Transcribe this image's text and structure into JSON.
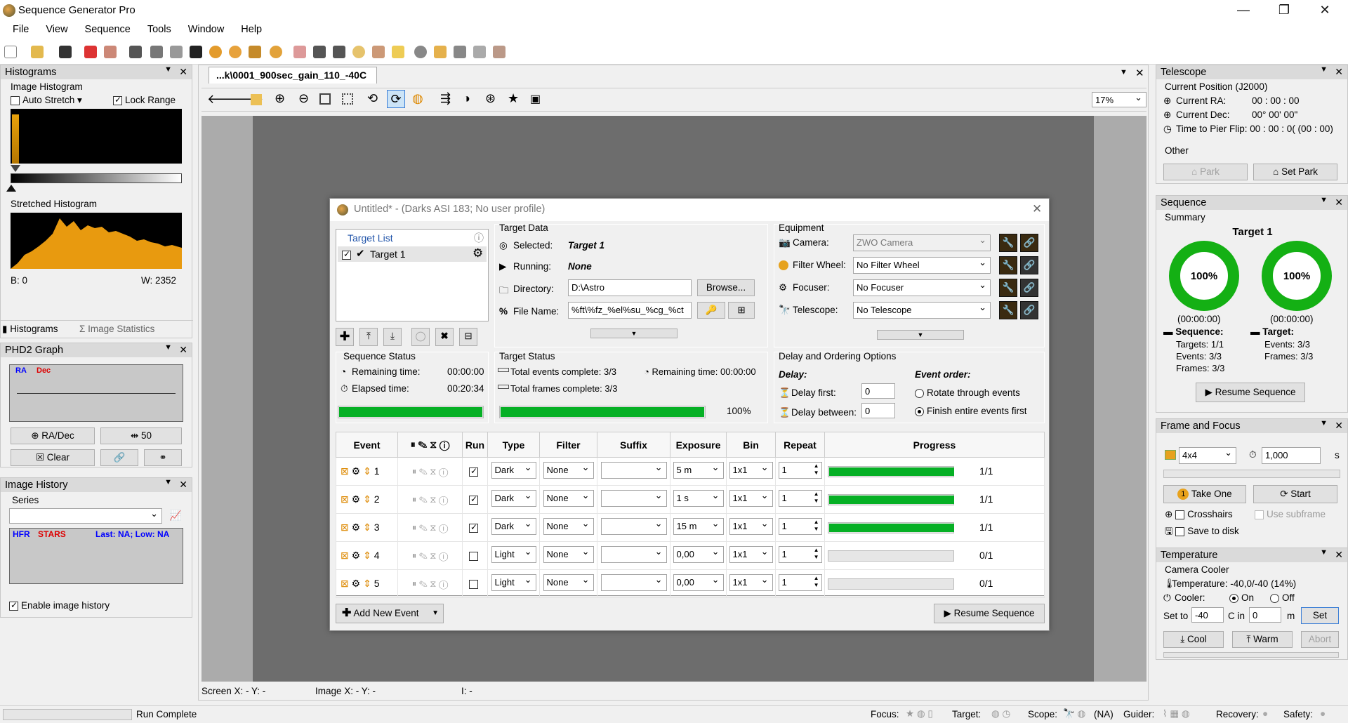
{
  "app": {
    "title": "Sequence Generator Pro"
  },
  "window": {
    "minimize": "—",
    "maximize": "❐",
    "close": "✕"
  },
  "menu": [
    "File",
    "View",
    "Sequence",
    "Tools",
    "Window",
    "Help"
  ],
  "histograms": {
    "title": "Histograms",
    "image_histogram": "Image Histogram",
    "auto_stretch": "Auto Stretch",
    "lock_range": "Lock Range",
    "stretched_histogram": "Stretched Histogram",
    "b_label": "B: 0",
    "w_label": "W:  2352",
    "tab_histograms": "Histograms",
    "tab_stats": "Image Statistics"
  },
  "phd2": {
    "title": "PHD2 Graph",
    "ra": "RA",
    "dec": "Dec",
    "radec_btn": "RA/Dec",
    "scale_btn": "50",
    "clear_btn": "Clear"
  },
  "image_history": {
    "title": "Image History",
    "series": "Series",
    "hfr": "HFR",
    "stars": "STARS",
    "last": "Last: NA; Low: NA",
    "enable": "Enable image history"
  },
  "doc": {
    "tab": "...k\\0001_900sec_gain_110_-40C",
    "zoom": "17%"
  },
  "dialog": {
    "title": "Untitled* - (Darks ASI 183; No user profile)",
    "target_list": "Target List",
    "target_item": "Target 1",
    "target_data": {
      "label": "Target Data",
      "selected_l": "Selected:",
      "selected_v": "Target 1",
      "running_l": "Running:",
      "running_v": "None",
      "dir_l": "Directory:",
      "dir_v": "D:\\Astro",
      "browse": "Browse...",
      "file_l": "File Name:",
      "file_v": "%ft\\%fz_%el%su_%cg_%ct"
    },
    "equipment": {
      "label": "Equipment",
      "camera_l": "Camera:",
      "camera_v": "ZWO Camera",
      "fw_l": "Filter Wheel:",
      "fw_v": "No Filter Wheel",
      "foc_l": "Focuser:",
      "foc_v": "No Focuser",
      "tel_l": "Telescope:",
      "tel_v": "No Telescope"
    },
    "seq_status": {
      "label": "Sequence Status",
      "rem_l": "Remaining time:",
      "rem_v": "00:00:00",
      "el_l": "Elapsed time:",
      "el_v": "00:20:34",
      "progress": 1.0
    },
    "target_status": {
      "label": "Target Status",
      "events": "Total events complete: 3/3",
      "rem": "Remaining time: 00:00:00",
      "frames": "Total frames complete: 3/3",
      "pct": "100%",
      "progress": 1.0
    },
    "delay": {
      "label": "Delay and Ordering Options",
      "delay_h": "Delay:",
      "first_l": "Delay first:",
      "first_v": "0",
      "between_l": "Delay between:",
      "between_v": "0",
      "order_h": "Event order:",
      "rot": "Rotate through events",
      "fin": "Finish entire events first"
    },
    "columns": [
      "Event",
      "Run",
      "Type",
      "Filter",
      "Suffix",
      "Exposure",
      "Bin",
      "Repeat",
      "Progress"
    ],
    "events": [
      {
        "n": "1",
        "run": true,
        "type": "Dark",
        "filter": "None",
        "suffix": "",
        "exp": "5 m",
        "bin": "1x1",
        "repeat": "1",
        "progress": 1.0,
        "count": "1/1"
      },
      {
        "n": "2",
        "run": true,
        "type": "Dark",
        "filter": "None",
        "suffix": "",
        "exp": "1 s",
        "bin": "1x1",
        "repeat": "1",
        "progress": 1.0,
        "count": "1/1"
      },
      {
        "n": "3",
        "run": true,
        "type": "Dark",
        "filter": "None",
        "suffix": "",
        "exp": "15 m",
        "bin": "1x1",
        "repeat": "1",
        "progress": 1.0,
        "count": "1/1"
      },
      {
        "n": "4",
        "run": false,
        "type": "Light",
        "filter": "None",
        "suffix": "",
        "exp": "0,00",
        "bin": "1x1",
        "repeat": "1",
        "progress": 0,
        "count": "0/1"
      },
      {
        "n": "5",
        "run": false,
        "type": "Light",
        "filter": "None",
        "suffix": "",
        "exp": "0,00",
        "bin": "1x1",
        "repeat": "1",
        "progress": 0,
        "count": "0/1"
      }
    ],
    "add_event": "Add New Event",
    "resume": "Resume Sequence"
  },
  "telescope": {
    "title": "Telescope",
    "current": "Current Position (J2000)",
    "ra": "Current RA:",
    "ra_v": "00 : 00 : 00",
    "dec": "Current Dec:",
    "dec_v": "00°  00'  00\"",
    "flip": "Time to Pier Flip: 00 : 00 : 0( (00 : 00)",
    "other": "Other",
    "park": "Park",
    "set_park": "Set Park"
  },
  "sequence": {
    "title": "Sequence",
    "summary": "Summary",
    "target": "Target 1",
    "pct1": "100%",
    "pct2": "100%",
    "t1": "(00:00:00)",
    "t2": "(00:00:00)",
    "seq_h": "Sequence:",
    "tgt_h": "Target:",
    "targets": "Targets:  1/1",
    "events": "Events:  3/3",
    "frames": "Frames:  3/3",
    "t_events": "Events:  3/3",
    "t_frames": "Frames:  3/3",
    "resume": "Resume Sequence"
  },
  "frame_focus": {
    "title": "Frame and Focus",
    "bin": "4x4",
    "exp": "1,000",
    "unit": "s",
    "take_one": "Take One",
    "start": "Start",
    "crosshairs": "Crosshairs",
    "subframe": "Use subframe",
    "save": "Save to disk"
  },
  "temperature": {
    "title": "Temperature",
    "cooler": "Camera Cooler",
    "temp": "Temperature: -40,0/-40 (14%)",
    "cooler_l": "Cooler:",
    "on": "On",
    "off": "Off",
    "set_to": "Set to",
    "set_v": "-40",
    "c_in": "C in",
    "min_v": "0",
    "m": "m",
    "set": "Set",
    "cool": "Cool",
    "warm": "Warm",
    "abort": "Abort"
  },
  "statusbar": {
    "screen": "Screen X: - Y: -",
    "image": "Image X: - Y: -",
    "i": "I: -",
    "run": "Run Complete",
    "focus": "Focus:",
    "target": "Target:",
    "scope": "Scope:",
    "na": "(NA)",
    "guider": "Guider:",
    "recovery": "Recovery:",
    "safety": "Safety:"
  }
}
